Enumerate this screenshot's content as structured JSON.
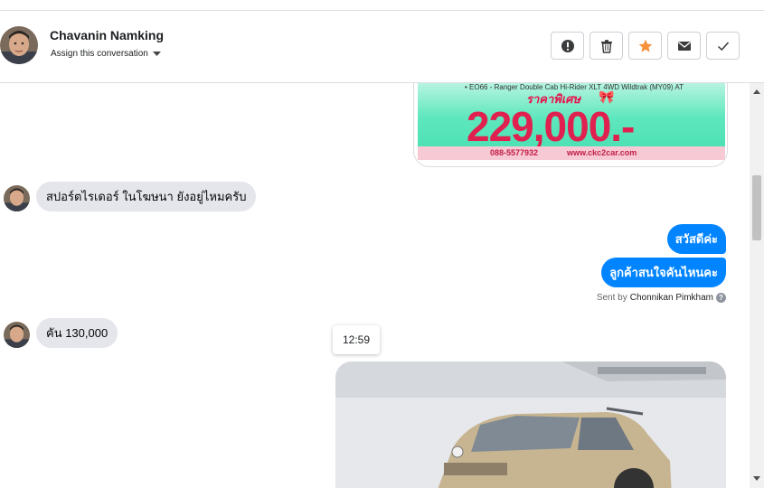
{
  "header": {
    "contact_name": "Chavanin Namking",
    "assign_label": "Assign this conversation",
    "actions": [
      {
        "name": "spam-button",
        "icon": "alert-circle-icon"
      },
      {
        "name": "delete-button",
        "icon": "trash-icon"
      },
      {
        "name": "star-button",
        "icon": "star-icon",
        "color": "#f7923b"
      },
      {
        "name": "email-button",
        "icon": "envelope-icon"
      },
      {
        "name": "done-button",
        "icon": "checkmark-icon"
      }
    ]
  },
  "ad_image": {
    "top_line": "• EO66 - Ranger Double Cab Hi-Rider XLT 4WD Wildtrak (MY09) AT",
    "special_price_label": "ราคาพิเศษ",
    "price": "229,000.-",
    "phone": "088-5577932",
    "url": "www.ckc2car.com"
  },
  "messages": {
    "incoming_1": "สปอร์ตไรเดอร์ ในโฆษนา ยังอยู่ไหมครับ",
    "outgoing_1": "สวัสดีค่ะ",
    "outgoing_2": "ลูกค้าสนใจคันไหนคะ",
    "sent_by_prefix": "Sent by",
    "sent_by_name": "Chonnikan Pimkham",
    "incoming_2": "คัน 130,000",
    "timestamp_tooltip": "12:59"
  },
  "colors": {
    "outgoing_bubble": "#0084ff",
    "incoming_bubble": "#e4e6eb",
    "accent_star": "#f7923b"
  }
}
